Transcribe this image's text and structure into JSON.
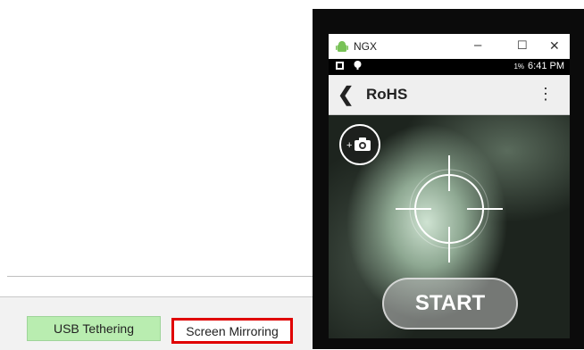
{
  "host": {
    "buttons": {
      "usb_tethering": "USB Tethering",
      "screen_mirroring": "Screen Mirroring"
    },
    "colors": {
      "usb_bg": "#b9edb0",
      "highlight": "#e00000"
    }
  },
  "device_window": {
    "title": "NGX",
    "controls": {
      "minimize": "–",
      "maximize": "☐",
      "close": "✕"
    },
    "status_bar": {
      "battery": "1%",
      "time": "6:41 PM"
    },
    "app_bar": {
      "title": "RoHS"
    },
    "camera": {
      "start_label": "START"
    }
  }
}
